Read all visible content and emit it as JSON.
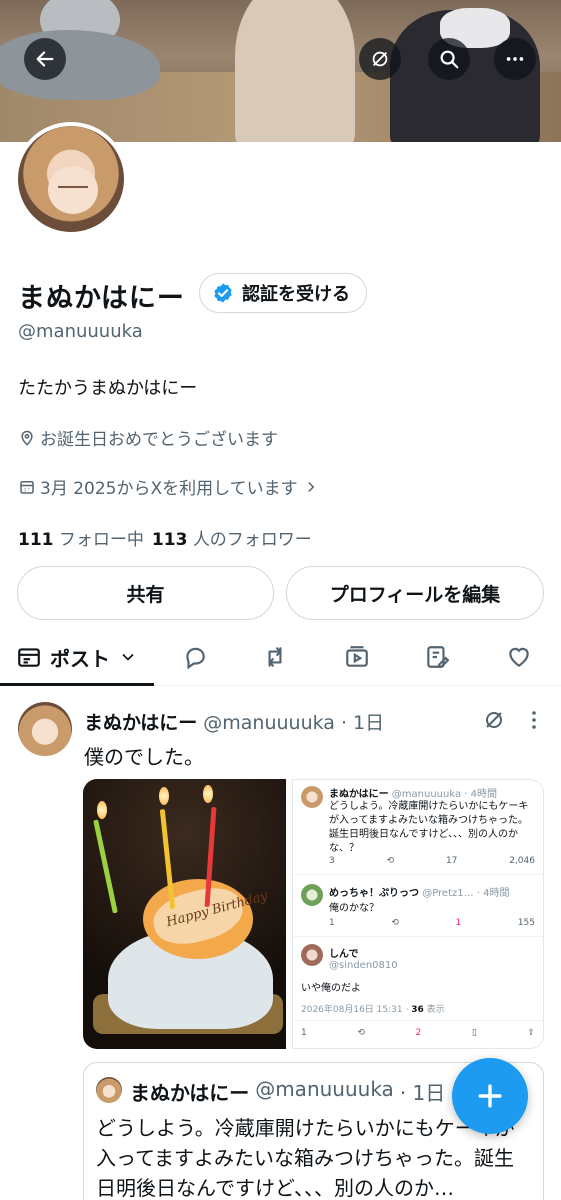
{
  "profile": {
    "name": "まぬかはにー",
    "handle": "@manuuuuka",
    "verify_label": "認証を受ける",
    "bio": "たたかうまぬかはにー",
    "location": "お誕生日おめでとうございます",
    "joined": "3月 2025からXを利用しています",
    "following_count": "111",
    "following_label": "フォロー中",
    "followers_count": "113",
    "followers_label": "人のフォロワー",
    "share_label": "共有",
    "edit_label": "プロフィールを編集"
  },
  "tabs": {
    "posts_label": "ポスト"
  },
  "post": {
    "name": "まぬかはにー",
    "handle": "@manuuuuka",
    "time": "· 1日",
    "text": "僕のでした。",
    "cake_text": "Happy Birthday"
  },
  "embedded": {
    "t1_name": "まぬかはにー",
    "t1_meta": "@manuuuuka · 4時間",
    "t1_text": "どうしよう。冷蔵庫開けたらいかにもケーキが入ってますよみたいな箱みつけちゃった。誕生日明後日なんですけど、、、別の人のかな、？",
    "t1_replies": "3",
    "t1_likes": "17",
    "t1_views": "2,046",
    "t2_name": "めっちゃ！ぷりっつ",
    "t2_meta": "@Pretz1… · 4時間",
    "t2_text": "俺のかな？",
    "t2_replies": "1",
    "t2_likes": "1",
    "t2_views": "155",
    "t3_name": "しんで",
    "t3_handle": "@sinden0810",
    "t3_text": "いや俺のだよ",
    "t3_date": "2026年08月16日 15:31 · ",
    "t3_views": "36",
    "t3_views_label": " 表示",
    "t3_replies": "1",
    "t3_likes": "2"
  },
  "quote": {
    "name": "まぬかはにー",
    "handle": "@manuuuuka",
    "time": "· 1日",
    "text": "どうしよう。冷蔵庫開けたらいかにもケーキが入ってますよみたいな箱みつけちゃった。誕生日明後日なんですけど、、、別の人のか…"
  },
  "icons": [
    "back-arrow-icon",
    "grok-icon",
    "search-icon",
    "more-icon",
    "verified-badge-icon",
    "location-icon",
    "calendar-icon",
    "chevron-right-icon",
    "chevron-down-icon",
    "reply-icon",
    "retweet-icon",
    "media-icon",
    "articles-icon",
    "heart-icon",
    "plus-icon"
  ],
  "colors": {
    "accent": "#1d9bf0",
    "like": "#f91880",
    "text_secondary": "#536471"
  }
}
